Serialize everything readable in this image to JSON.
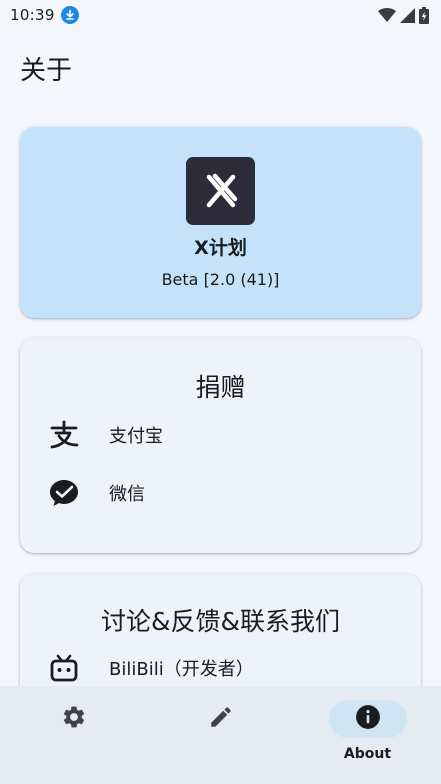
{
  "status_bar": {
    "time": "10:39",
    "icons": [
      "download-notification-icon",
      "wifi-icon",
      "cellular-signal-icon",
      "battery-charging-icon"
    ]
  },
  "page": {
    "title": "关于"
  },
  "app_card": {
    "name": "X计划",
    "version": "Beta [2.0 (41)]",
    "icon": "app-logo-x-icon",
    "background": "#c4e3fb"
  },
  "donate": {
    "heading": "捐赠",
    "items": [
      {
        "label": "支付宝",
        "icon": "alipay-icon"
      },
      {
        "label": "微信",
        "icon": "wechat-icon"
      }
    ]
  },
  "contact": {
    "heading": "讨论&反馈&联系我们",
    "items": [
      {
        "label": "BiliBili（开发者）",
        "icon": "bilibili-icon"
      }
    ]
  },
  "bottom_nav": {
    "items": [
      {
        "label": "",
        "icon": "gear-icon",
        "active": false
      },
      {
        "label": "",
        "icon": "pencil-icon",
        "active": false
      },
      {
        "label": "About",
        "icon": "info-icon",
        "active": true
      }
    ]
  },
  "colors": {
    "background": "#f3f7fc",
    "card": "#eef3f9",
    "app_card": "#c4e3fb",
    "nav_bar": "#e5ebf1",
    "nav_active_pill": "#cfe5f4",
    "text": "#1a1c1e"
  }
}
